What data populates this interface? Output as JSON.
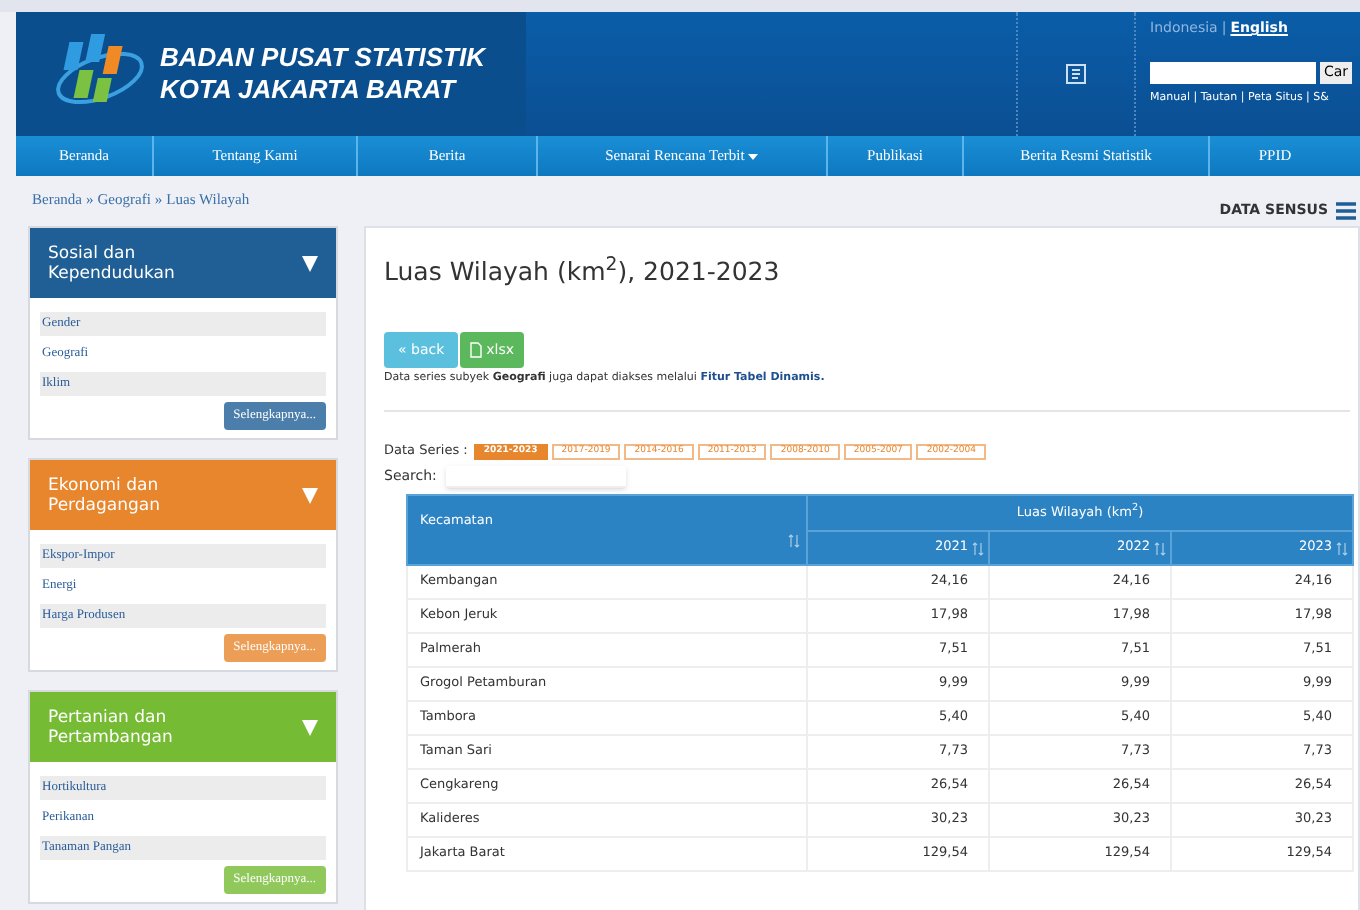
{
  "header": {
    "title_line1": "BADAN PUSAT STATISTIK",
    "title_line2": "KOTA JAKARTA BARAT",
    "languages": [
      {
        "label": "Indonesia",
        "selected": false
      },
      {
        "label": "English",
        "selected": true
      }
    ],
    "language_separator": "|",
    "search_button": "Car",
    "links": "Manual | Tautan | Peta Situs | S&"
  },
  "nav": [
    {
      "label": "Beranda",
      "dropdown": false
    },
    {
      "label": "Tentang Kami",
      "dropdown": false
    },
    {
      "label": "Berita",
      "dropdown": false
    },
    {
      "label": "Senarai Rencana Terbit",
      "dropdown": true
    },
    {
      "label": "Publikasi",
      "dropdown": false
    },
    {
      "label": "Berita Resmi Statistik",
      "dropdown": false
    },
    {
      "label": "PPID",
      "dropdown": false
    }
  ],
  "breadcrumb": [
    "Beranda",
    "Geografi",
    "Luas Wilayah"
  ],
  "breadcrumb_separators": [
    "»",
    "»"
  ],
  "data_sensus": "DATA SENSUS",
  "sidebar": [
    {
      "title": "Sosial dan Kependudukan",
      "color": "#1f5f95",
      "items": [
        "Gender",
        "Geografi",
        "Iklim"
      ],
      "more": "Selengkapnya..."
    },
    {
      "title": "Ekonomi dan Perdagangan",
      "color": "#e8862d",
      "items": [
        "Ekspor-Impor",
        "Energi",
        "Harga Produsen"
      ],
      "more": "Selengkapnya..."
    },
    {
      "title": "Pertanian dan Pertambangan",
      "color": "#76bb34",
      "items": [
        "Hortikultura",
        "Perikanan",
        "Tanaman Pangan"
      ],
      "more": "Selengkapnya..."
    }
  ],
  "main": {
    "title": "Luas Wilayah (km$^{2}$), 2021-2023",
    "back_button": "« back",
    "xlsx_button": "xlsx",
    "note": "Data series subyek **Geografi** juga dapat diakses melalui",
    "note_link": "Fitur Tabel Dinamis.",
    "series_label": "Data Series :",
    "series": [
      {
        "label": "2021-2023",
        "selected": true
      },
      {
        "label": "2017-2019",
        "selected": false
      },
      {
        "label": "2014-2016",
        "selected": false
      },
      {
        "label": "2011-2013",
        "selected": false
      },
      {
        "label": "2008-2010",
        "selected": false
      },
      {
        "label": "2005-2007",
        "selected": false
      },
      {
        "label": "2002-2004",
        "selected": false
      }
    ],
    "search_label": "Search:",
    "table": {
      "group_header": "Luas Wilayah (km$^{2}$)",
      "columns": [
        "Kecamatan",
        "2021",
        "2022",
        "2023"
      ],
      "rows": [
        [
          "Kembangan",
          "24,16",
          "24,16",
          "24,16"
        ],
        [
          "Kebon Jeruk",
          "17,98",
          "17,98",
          "17,98"
        ],
        [
          "Palmerah",
          "7,51",
          "7,51",
          "7,51"
        ],
        [
          "Grogol Petamburan",
          "9,99",
          "9,99",
          "9,99"
        ],
        [
          "Tambora",
          "5,40",
          "5,40",
          "5,40"
        ],
        [
          "Taman Sari",
          "7,73",
          "7,73",
          "7,73"
        ],
        [
          "Cengkareng",
          "26,54",
          "26,54",
          "26,54"
        ],
        [
          "Kalideres",
          "30,23",
          "30,23",
          "30,23"
        ],
        [
          "Jakarta Barat",
          "129,54",
          "129,54",
          "129,54"
        ]
      ]
    }
  }
}
